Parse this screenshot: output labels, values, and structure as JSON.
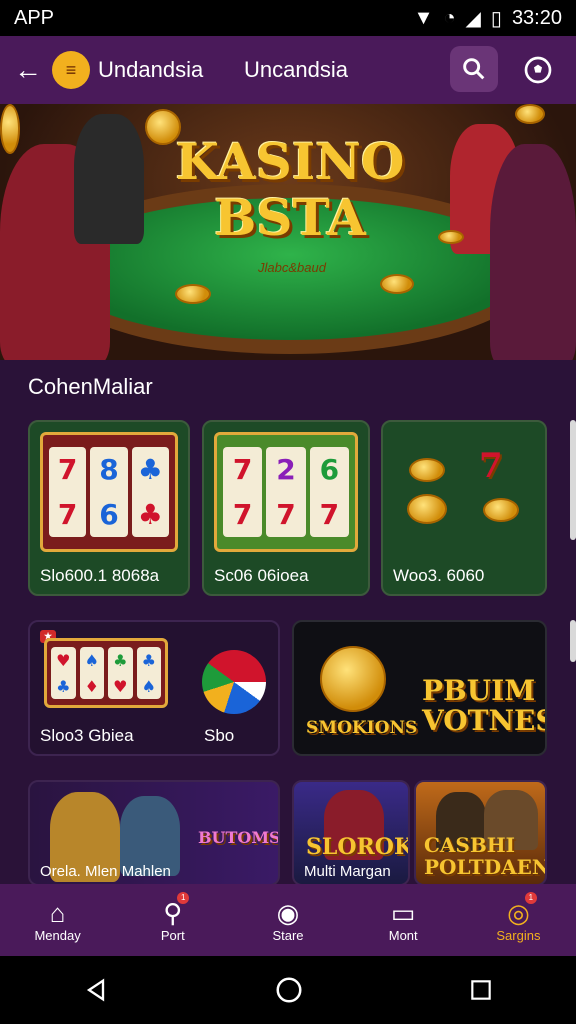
{
  "status": {
    "left": "APP",
    "time": "33:20"
  },
  "appbar": {
    "name": "Undandsia",
    "subtitle": "Uncandsia"
  },
  "hero": {
    "title_line1": "KASINO",
    "title_line2": "BSTA",
    "subtitle": "Jlabc&baud"
  },
  "section": {
    "title": "CohenMaliar"
  },
  "cards_row1": [
    {
      "label": "Slo600.1 8068a"
    },
    {
      "label": "Sc06 06ioea"
    },
    {
      "label": "Woo3. 6060"
    }
  ],
  "cards_row2": [
    {
      "label": "Sloo3 Gbiea",
      "label2": "Sbo"
    },
    {
      "label": "SMOKIONS",
      "title_line1": "PBUIM",
      "title_line2": "VOTNES"
    }
  ],
  "cards_row3": [
    {
      "label": "Orela. Mlen Mahlen",
      "title": "BUTOMS"
    },
    {
      "label": "Multi Margan",
      "title": "SLOROK"
    },
    {
      "label": "",
      "title_line1": "CASBHI",
      "title_line2": "POLTDAENS"
    }
  ],
  "bottom_nav": [
    {
      "label": "Menday",
      "icon": "home-icon"
    },
    {
      "label": "Port",
      "icon": "search-icon",
      "badge": "1"
    },
    {
      "label": "Stare",
      "icon": "compass-icon"
    },
    {
      "label": "Mont",
      "icon": "tv-icon"
    },
    {
      "label": "Sargins",
      "icon": "target-icon",
      "badge": "1"
    }
  ],
  "colors": {
    "appbar": "#4a1a5a",
    "accent": "#f2b01e",
    "background": "#2a1238"
  }
}
